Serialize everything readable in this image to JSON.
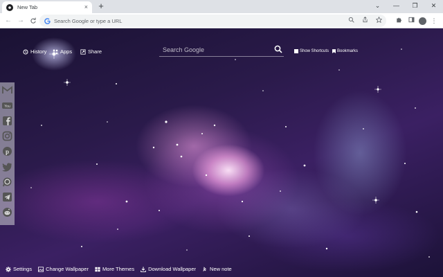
{
  "browser": {
    "tab": {
      "title": "New Tab",
      "close_glyph": "×"
    },
    "new_tab_glyph": "+",
    "window_controls": {
      "minimize": "⌄",
      "restore": "—",
      "maximize": "❐",
      "close": "✕"
    },
    "nav": {
      "back": "←",
      "forward": "→",
      "reload": "C"
    },
    "omnibox": {
      "placeholder": "Search Google or type a URL"
    },
    "toolbar_icons": [
      "zoom-icon",
      "share-icon",
      "bookmark-star-icon",
      "extensions-icon",
      "side-panel-icon",
      "profile-icon",
      "menu-icon"
    ]
  },
  "newtab": {
    "top_links": [
      {
        "label": "History",
        "icon": "history-icon"
      },
      {
        "label": "Apps",
        "icon": "apps-grid-icon"
      },
      {
        "label": "Share",
        "icon": "share-icon"
      }
    ],
    "search": {
      "placeholder": "Search Google"
    },
    "right_links": [
      {
        "label": "Show Shortcuts",
        "icon": "grid-icon"
      },
      {
        "label": "Bookmarks",
        "icon": "bookmark-icon"
      }
    ],
    "social_icons": [
      "gmail-icon",
      "youtube-icon",
      "facebook-icon",
      "instagram-icon",
      "pinterest-icon",
      "twitter-icon",
      "whatsapp-icon",
      "telegram-icon",
      "reddit-icon"
    ],
    "bottom_links": [
      {
        "label": "Settings",
        "icon": "gear-icon"
      },
      {
        "label": "Change Wallpaper",
        "icon": "image-icon"
      },
      {
        "label": "More Themes",
        "icon": "themes-grid-icon"
      },
      {
        "label": "Download Wallpaper",
        "icon": "download-icon"
      },
      {
        "label": "New note",
        "icon": "note-pin-icon"
      }
    ]
  },
  "colors": {
    "tabstrip": "#dee1e6",
    "toolbar": "#ffffff",
    "omnibox": "#f1f3f4",
    "galaxy_core": "#f5c6ec",
    "galaxy_dark": "#1a1233"
  }
}
